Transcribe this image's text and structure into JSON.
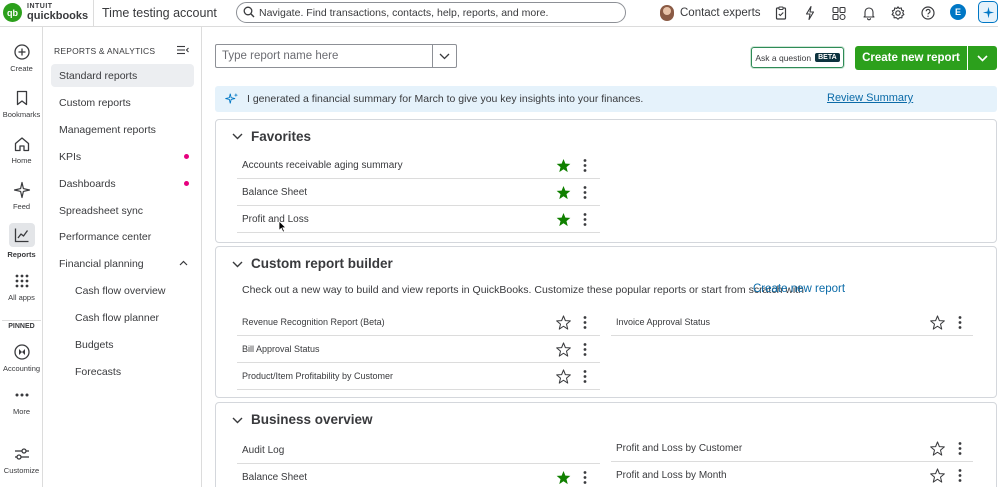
{
  "topbar": {
    "brand_top": "INTUIT",
    "brand_bottom": "quickbooks",
    "logo_glyph": "qb",
    "company": "Time testing account",
    "search_placeholder": "Navigate. Find transactions, contacts, help, reports, and more.",
    "contact_label": "Contact experts",
    "user_initial": "E",
    "icons": [
      "clipboard-icon",
      "lightning-icon",
      "apps-icon",
      "bell-icon",
      "gear-icon",
      "help-icon",
      "ai-sparkle-icon"
    ]
  },
  "rail": {
    "items": [
      {
        "label": "Create",
        "icon": "plus-circle-icon"
      },
      {
        "label": "Bookmarks",
        "icon": "bookmark-icon"
      },
      {
        "label": "Home",
        "icon": "home-icon"
      },
      {
        "label": "Feed",
        "icon": "feed-sparkle-icon"
      },
      {
        "label": "Reports",
        "icon": "chart-icon",
        "active": true
      },
      {
        "label": "All apps",
        "icon": "grid-icon"
      }
    ],
    "pinned_label": "PINNED",
    "pinned_items": [
      {
        "label": "Accounting",
        "icon": "accounting-icon"
      },
      {
        "label": "More",
        "icon": "more-icon"
      },
      {
        "label": "Customize",
        "icon": "sliders-icon"
      }
    ]
  },
  "sidebar": {
    "heading": "REPORTS & ANALYTICS",
    "items": [
      {
        "label": "Standard reports",
        "active": true
      },
      {
        "label": "Custom reports"
      },
      {
        "label": "Management reports"
      },
      {
        "label": "KPIs",
        "dot": true
      },
      {
        "label": "Dashboards",
        "dot": true
      },
      {
        "label": "Spreadsheet sync"
      },
      {
        "label": "Performance center"
      },
      {
        "label": "Financial planning",
        "expanded": true
      },
      {
        "label": "Cash flow overview",
        "sub": true
      },
      {
        "label": "Cash flow planner",
        "sub": true
      },
      {
        "label": "Budgets",
        "sub": true
      },
      {
        "label": "Forecasts",
        "sub": true
      }
    ],
    "dot_color": "#e6007e"
  },
  "main": {
    "report_input_placeholder": "Type report name here",
    "ask_label": "Ask a question",
    "beta_label": "BETA",
    "create_label": "Create new report",
    "banner_message": "I generated a financial summary for March to give you key insights into your finances.",
    "banner_link": "Review Summary",
    "favorites": {
      "title": "Favorites",
      "rows": [
        {
          "name": "Accounts receivable aging summary",
          "starred": true
        },
        {
          "name": "Balance Sheet",
          "starred": true
        },
        {
          "name": "Profit and Loss",
          "starred": true
        }
      ]
    },
    "custom_builder": {
      "title": "Custom report builder",
      "description": "Check out a new way to build and view reports in QuickBooks. Customize these popular reports or start from scratch with",
      "link": "Create new report",
      "left_rows": [
        {
          "name": "Revenue Recognition Report (Beta)",
          "starred": false
        },
        {
          "name": "Bill Approval Status",
          "starred": false
        },
        {
          "name": "Product/Item Profitability by Customer",
          "starred": false
        }
      ],
      "right_rows": [
        {
          "name": "Invoice Approval Status",
          "starred": false
        }
      ]
    },
    "business_overview": {
      "title": "Business overview",
      "left_rows": [
        {
          "name": "Audit Log",
          "starred": false
        },
        {
          "name": "Balance Sheet",
          "starred": true
        }
      ],
      "right_rows": [
        {
          "name": "Profit and Loss by Customer",
          "starred": false
        },
        {
          "name": "Profit and Loss by Month",
          "starred": false
        }
      ]
    }
  },
  "colors": {
    "brand_green": "#2ca01c",
    "star_green": "#108000",
    "link_blue": "#0b6ba8",
    "banner_bg": "#e5f2fb"
  }
}
